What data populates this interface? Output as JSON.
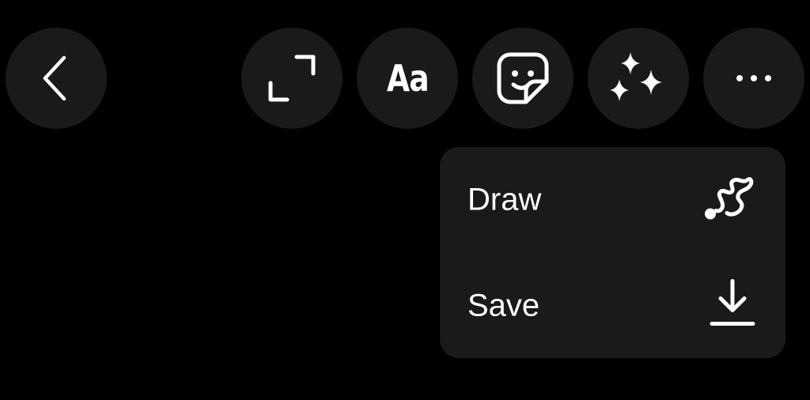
{
  "toolbar": {
    "back_icon": "chevron-left-icon",
    "expand_icon": "expand-icon",
    "text_label": "Aa",
    "sticker_icon": "sticker-icon",
    "effects_icon": "sparkles-icon",
    "more_icon": "more-horizontal-icon"
  },
  "menu": {
    "items": [
      {
        "label": "Draw",
        "icon": "scribble-icon"
      },
      {
        "label": "Save",
        "icon": "download-icon"
      }
    ]
  },
  "colors": {
    "background": "#000000",
    "button": "#1a1a1a",
    "foreground": "#ffffff"
  }
}
